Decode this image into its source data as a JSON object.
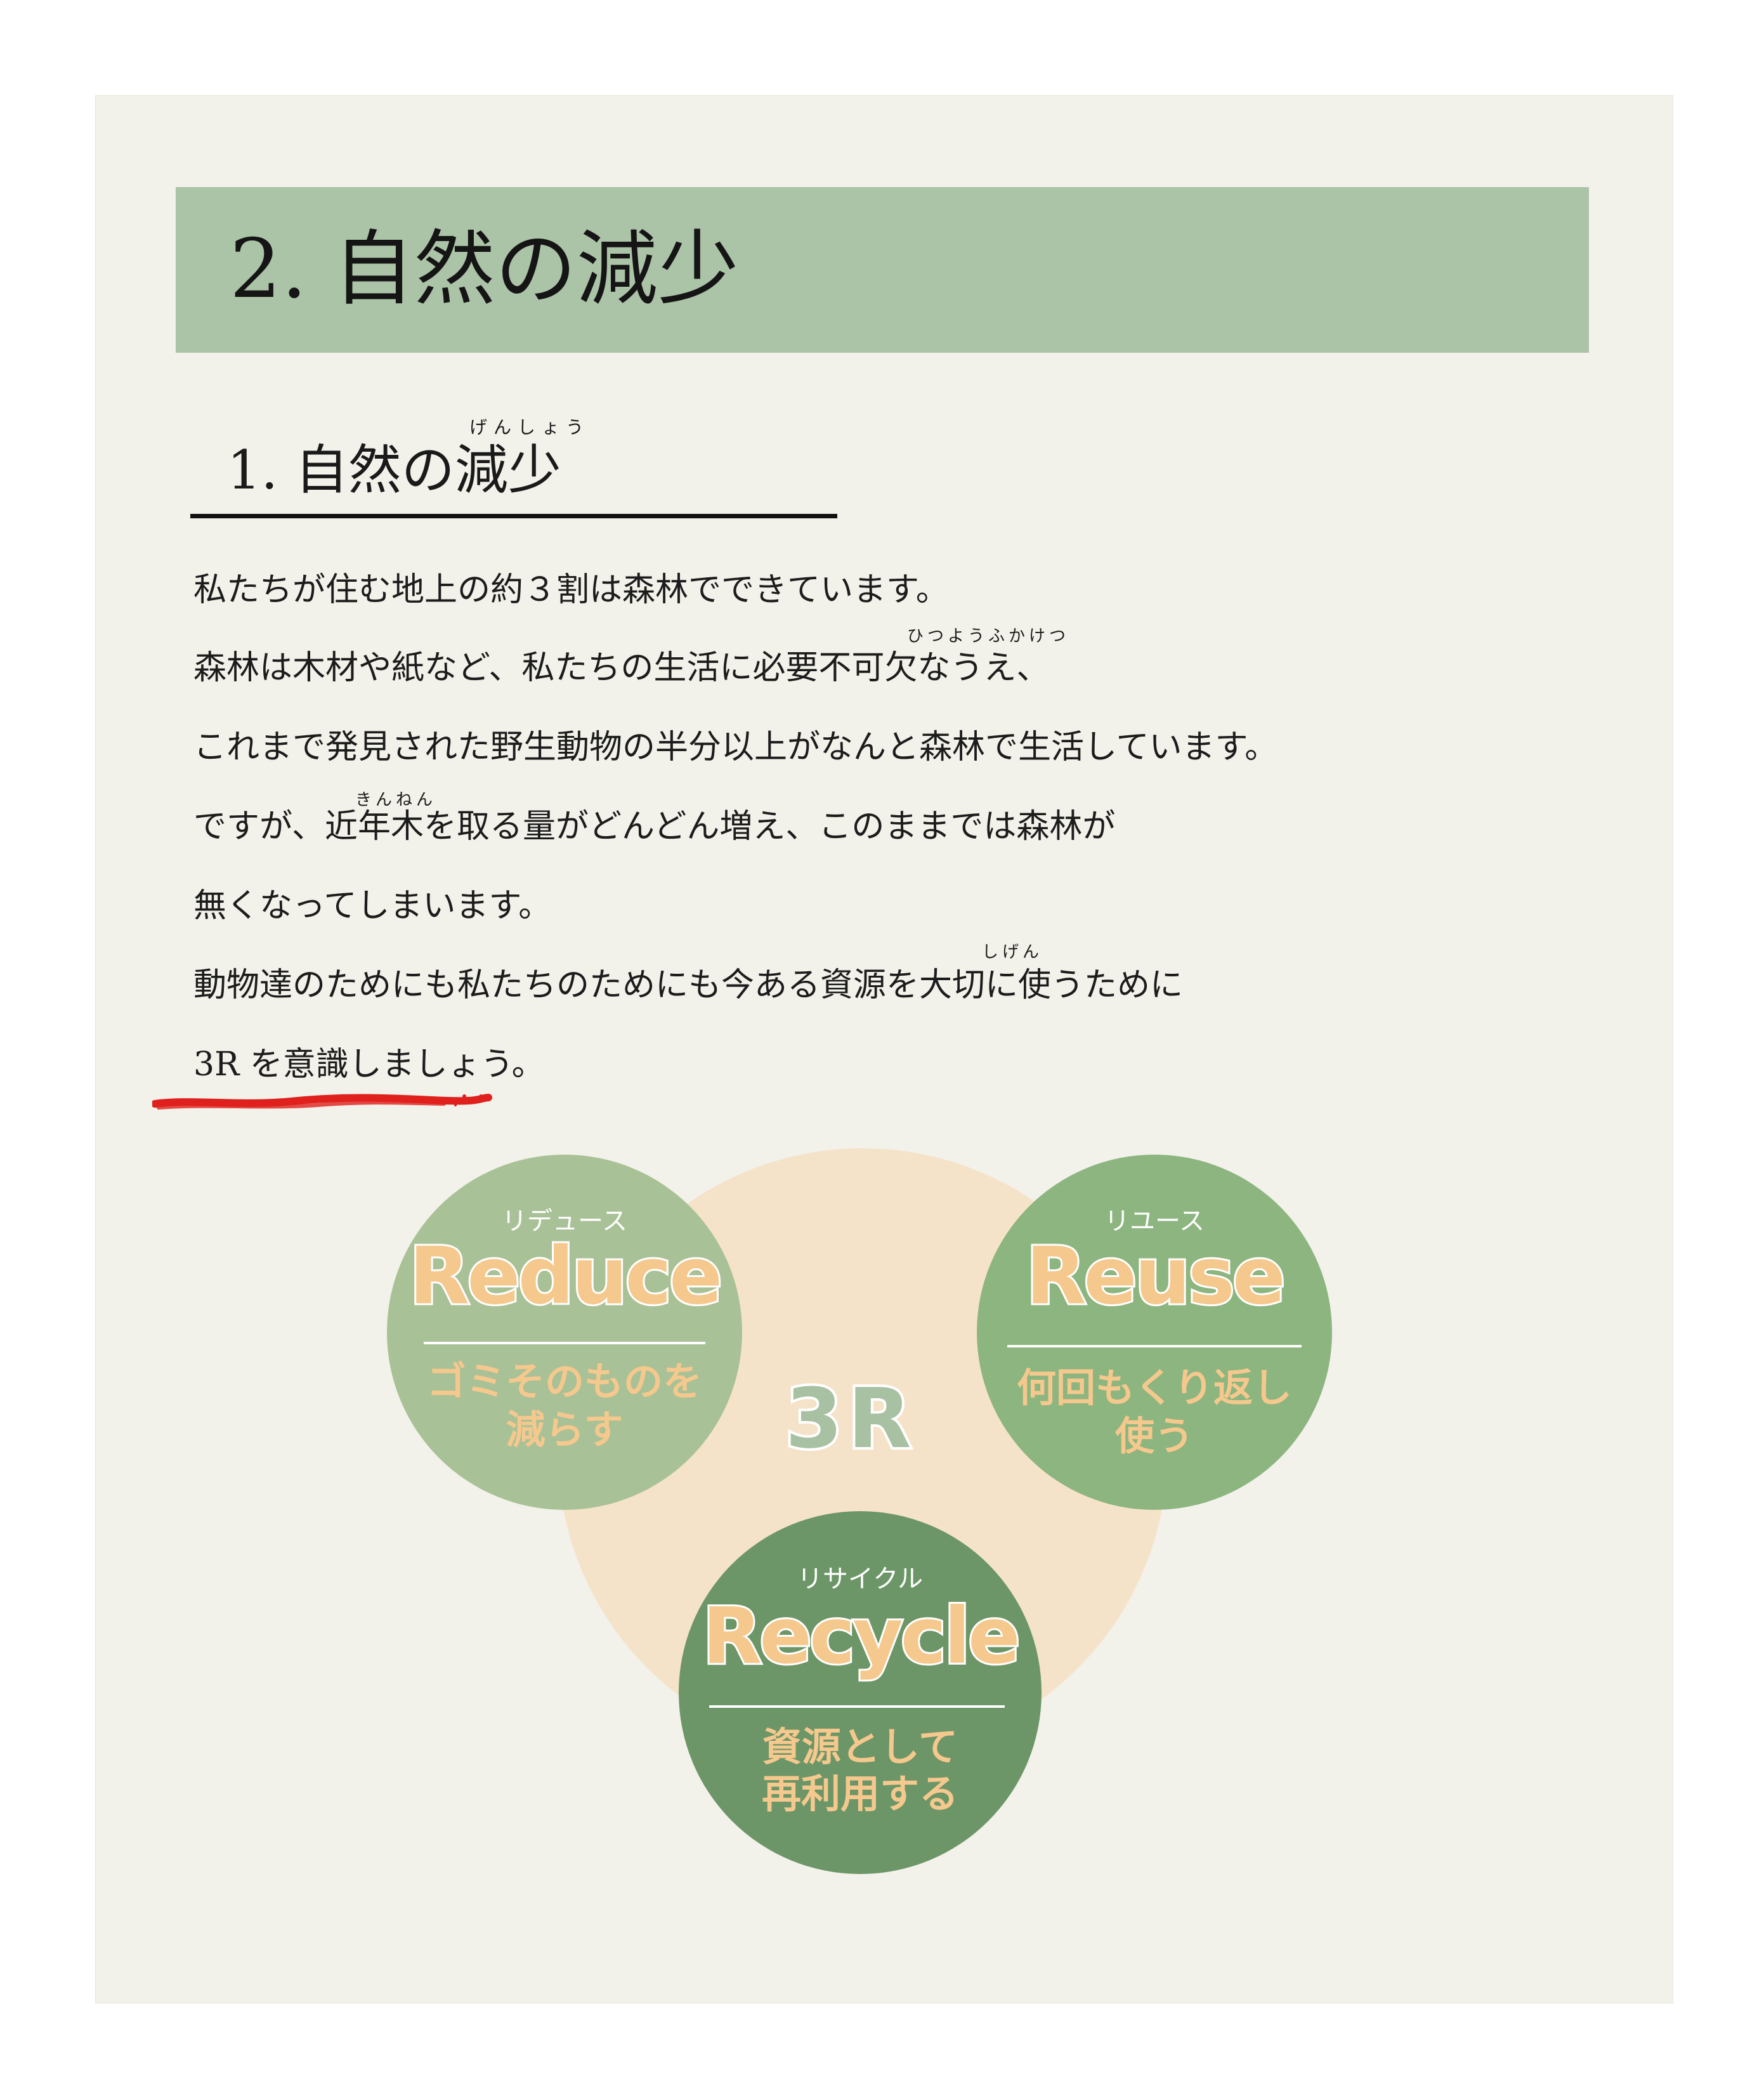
{
  "banner": {
    "title": "2. 自然の減少"
  },
  "section": {
    "ruby": "げんしょう",
    "title": "1. 自然の減少"
  },
  "body": {
    "lines": [
      "私たちが住む地上の約３割は森林でできています。",
      "森林は木材や紙など、私たちの生活に必要不可欠なうえ、",
      "これまで発見された野生動物の半分以上がなんと森林で生活しています。",
      "ですが、近年木を取る量がどんどん増え、このままでは森林が",
      "無くなってしまいます。",
      "動物達のためにも私たちのためにも今ある資源を大切に使うために",
      "3R を意識しましょう。"
    ],
    "ruby": {
      "hitsuyou": "ひつようふかけつ",
      "kinnen": "きんねん",
      "shigen": "しげん"
    }
  },
  "diagram": {
    "center": "3R",
    "reduce": {
      "kana": "リデュース",
      "word": "Reduce",
      "desc1": "ゴミそのものを",
      "desc2": "減らす"
    },
    "reuse": {
      "kana": "リユース",
      "word": "Reuse",
      "desc1": "何回もくり返し",
      "desc2": "使う"
    },
    "recycle": {
      "kana": "リサイクル",
      "word": "Recycle",
      "desc1": "資源として",
      "desc2": "再利用する"
    },
    "colors": {
      "big": "#f5e3c9",
      "reduce": "#a9c196",
      "reuse": "#8cb57f",
      "recycle": "#6c9667",
      "accent": "#f5c88e"
    }
  }
}
